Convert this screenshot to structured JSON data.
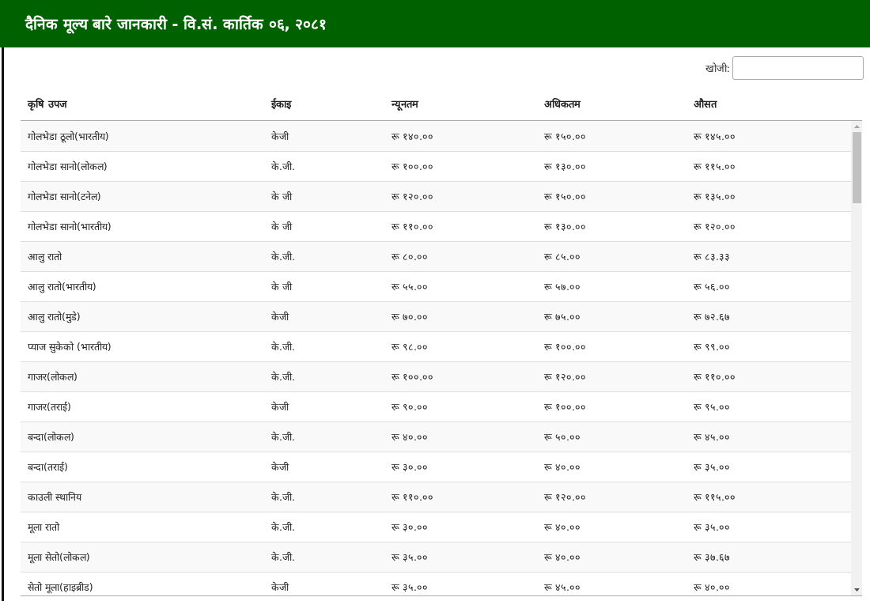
{
  "header": {
    "title": "दैनिक मूल्य बारे जानकारी - वि.सं. कार्तिक ०६, २०८१"
  },
  "search": {
    "label": "खोजी:"
  },
  "table": {
    "columns": [
      "कृषि उपज",
      "ईकाइ",
      "न्यूनतम",
      "अधिकतम",
      "औसत"
    ],
    "rows": [
      [
        "गोलभेडा ठूलो(भारतीय)",
        "केजी",
        "रू १४०.००",
        "रू १५०.००",
        "रू १४५.००"
      ],
      [
        "गोलभेडा सानो(लोकल)",
        "के.जी.",
        "रू १००.००",
        "रू १३०.००",
        "रू ११५.००"
      ],
      [
        "गोलभेडा सानो(टनेल)",
        "के जी",
        "रू १२०.००",
        "रू १५०.००",
        "रू १३५.००"
      ],
      [
        "गोलभेडा सानो(भारतीय)",
        "के जी",
        "रू ११०.००",
        "रू १३०.००",
        "रू १२०.००"
      ],
      [
        "आलु रातो",
        "के.जी.",
        "रू ८०.००",
        "रू ८५.००",
        "रू ८३.३३"
      ],
      [
        "आलु रातो(भारतीय)",
        "के जी",
        "रू ५५.००",
        "रू ५७.००",
        "रू ५६.००"
      ],
      [
        "आलु रातो(मुडे)",
        "केजी",
        "रू ७०.००",
        "रू ७५.००",
        "रू ७२.६७"
      ],
      [
        "प्याज सुकेको (भारतीय)",
        "के.जी.",
        "रू ९८.००",
        "रू १००.००",
        "रू ९९.००"
      ],
      [
        "गाजर(लोकल)",
        "के.जी.",
        "रू १००.००",
        "रू १२०.००",
        "रू ११०.००"
      ],
      [
        "गाजर(तराई)",
        "केजी",
        "रू ९०.००",
        "रू १००.००",
        "रू ९५.००"
      ],
      [
        "बन्दा(लोकल)",
        "के.जी.",
        "रू ४०.००",
        "रू ५०.००",
        "रू ४५.००"
      ],
      [
        "बन्दा(तराई)",
        "केजी",
        "रू ३०.००",
        "रू ४०.००",
        "रू ३५.००"
      ],
      [
        "काउली स्थानिय",
        "के.जी.",
        "रू ११०.००",
        "रू १२०.००",
        "रू ११५.००"
      ],
      [
        "मूला रातो",
        "के.जी.",
        "रू ३०.००",
        "रू ४०.००",
        "रू ३५.००"
      ],
      [
        "मूला सेतो(लोकल)",
        "के.जी.",
        "रू ३५.००",
        "रू ४०.००",
        "रू ३७.६७"
      ],
      [
        "सेतो मूला(हाइब्रीड)",
        "केजी",
        "रू ३५.००",
        "रू ४५.००",
        "रू ४०.००"
      ]
    ]
  }
}
